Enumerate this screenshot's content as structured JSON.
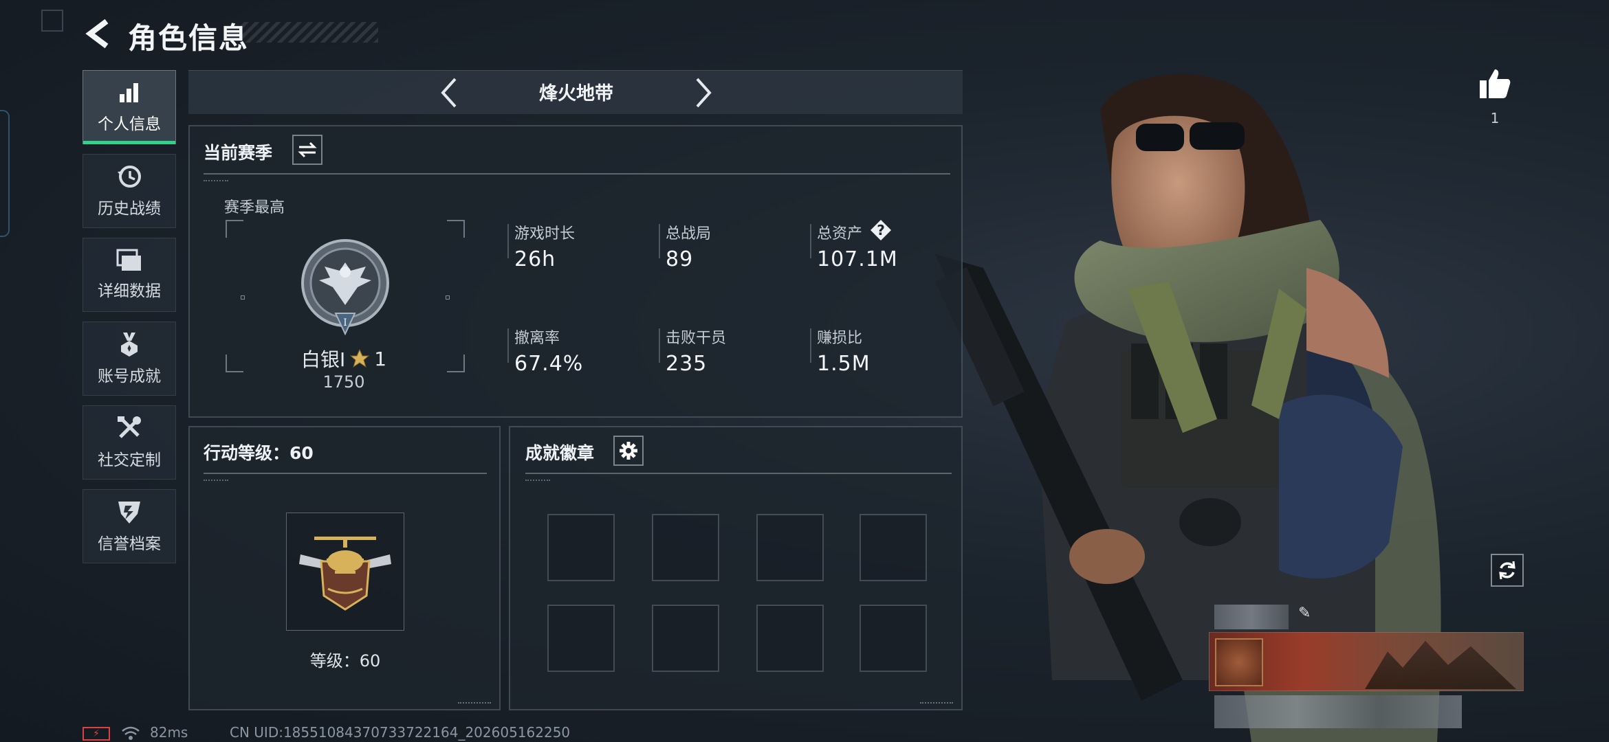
{
  "header": {
    "title": "角色信息",
    "back_icon": "chevron-left-icon"
  },
  "sidebar": {
    "items": [
      {
        "label": "个人信息",
        "icon": "bar-chart-icon",
        "active": true
      },
      {
        "label": "历史战绩",
        "icon": "history-clock-icon",
        "active": false
      },
      {
        "label": "详细数据",
        "icon": "folder-icon",
        "active": false
      },
      {
        "label": "账号成就",
        "icon": "medal-icon",
        "active": false
      },
      {
        "label": "社交定制",
        "icon": "tools-icon",
        "active": false
      },
      {
        "label": "信誉档案",
        "icon": "shield-icon",
        "active": false
      }
    ]
  },
  "mode": {
    "title": "烽火地带"
  },
  "season": {
    "title": "当前赛季",
    "best_label": "赛季最高",
    "rank_name": "白银I",
    "rank_stars": "1",
    "rank_score": "1750",
    "stats": [
      {
        "label": "游戏时长",
        "value": "26h"
      },
      {
        "label": "总战局",
        "value": "89"
      },
      {
        "label": "总资产",
        "value": "107.1M",
        "help": "?"
      },
      {
        "label": "撤离率",
        "value": "67.4%"
      },
      {
        "label": "击败干员",
        "value": "235"
      },
      {
        "label": "赚损比",
        "value": "1.5M"
      }
    ]
  },
  "action_level": {
    "title": "行动等级：60",
    "level_text": "等级：60"
  },
  "badges": {
    "title": "成就徽章",
    "slots": 8
  },
  "right": {
    "like_count": "1"
  },
  "footer": {
    "ping": "82ms",
    "uid": "CN UID:18551084370733722164_202605162250"
  },
  "colors": {
    "accent": "#2fd38a",
    "battery": "#e04040",
    "gold": "#d8b25a"
  }
}
